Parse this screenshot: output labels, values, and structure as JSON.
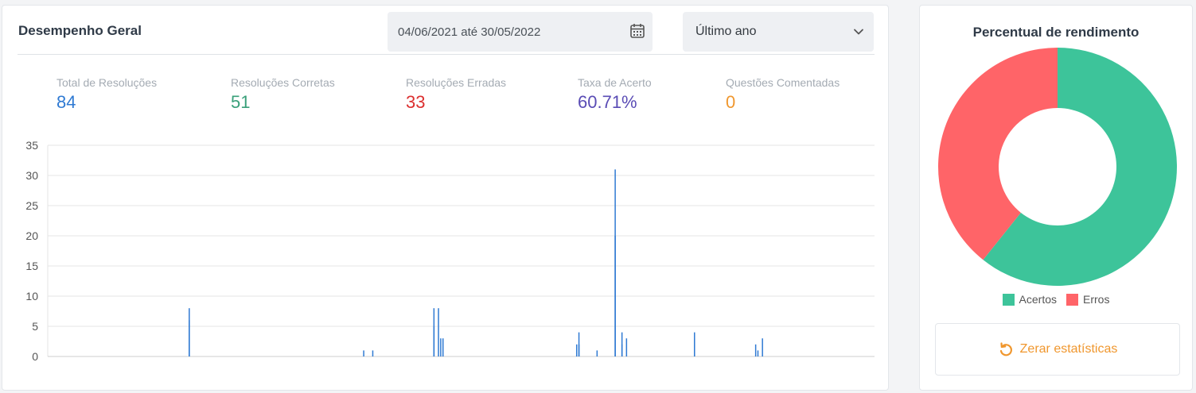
{
  "performance": {
    "title": "Desempenho Geral",
    "date_range": "04/06/2021 até 30/05/2022",
    "period_select": "Último ano",
    "stats": [
      {
        "label": "Total de Resoluções",
        "value": "84",
        "color": "#2f7ad3"
      },
      {
        "label": "Resoluções Corretas",
        "value": "51",
        "color": "#3aa07a"
      },
      {
        "label": "Resoluções Erradas",
        "value": "33",
        "color": "#dc2f2f"
      },
      {
        "label": "Taxa de Acerto",
        "value": "60.71%",
        "color": "#5a4cb5"
      },
      {
        "label": "Questões Comentadas",
        "value": "0",
        "color": "#f0972e"
      }
    ]
  },
  "chart_data": {
    "type": "bar",
    "ylim": [
      0,
      35
    ],
    "y_ticks": [
      "0",
      "5",
      "10",
      "15",
      "20",
      "25",
      "30",
      "35"
    ],
    "grid": true,
    "bar_color": "#2f7ad3",
    "x_start": "2021-06-04",
    "x_end": "2022-05-30",
    "bars": [
      {
        "x": "2021-08-03",
        "y": 8
      },
      {
        "x": "2021-08-03",
        "y": 6
      },
      {
        "x": "2021-10-19",
        "y": 1
      },
      {
        "x": "2021-10-23",
        "y": 1
      },
      {
        "x": "2021-11-19",
        "y": 8
      },
      {
        "x": "2021-11-19",
        "y": 5
      },
      {
        "x": "2021-11-21",
        "y": 8
      },
      {
        "x": "2021-11-22",
        "y": 3
      },
      {
        "x": "2021-11-23",
        "y": 3
      },
      {
        "x": "2022-01-21",
        "y": 2
      },
      {
        "x": "2022-01-22",
        "y": 4
      },
      {
        "x": "2022-01-22",
        "y": 2
      },
      {
        "x": "2022-01-30",
        "y": 1
      },
      {
        "x": "2022-02-07",
        "y": 31
      },
      {
        "x": "2022-02-07",
        "y": 20
      },
      {
        "x": "2022-02-10",
        "y": 4
      },
      {
        "x": "2022-02-10",
        "y": 2
      },
      {
        "x": "2022-02-12",
        "y": 3
      },
      {
        "x": "2022-03-14",
        "y": 4
      },
      {
        "x": "2022-03-14",
        "y": 3
      },
      {
        "x": "2022-04-10",
        "y": 2
      },
      {
        "x": "2022-04-11",
        "y": 1
      },
      {
        "x": "2022-04-13",
        "y": 3
      }
    ]
  },
  "percent": {
    "title": "Percentual de rendimento",
    "legend": [
      {
        "label": "Acertos",
        "color": "#3dc49a"
      },
      {
        "label": "Erros",
        "color": "#ff6468"
      }
    ],
    "reset_label": "Zerar estatísticas",
    "reset_color": "#f0972e"
  },
  "donut_data": {
    "type": "pie",
    "values": [
      51,
      33
    ],
    "labels": [
      "Acertos",
      "Erros"
    ],
    "colors": [
      "#3dc49a",
      "#ff6468"
    ]
  }
}
